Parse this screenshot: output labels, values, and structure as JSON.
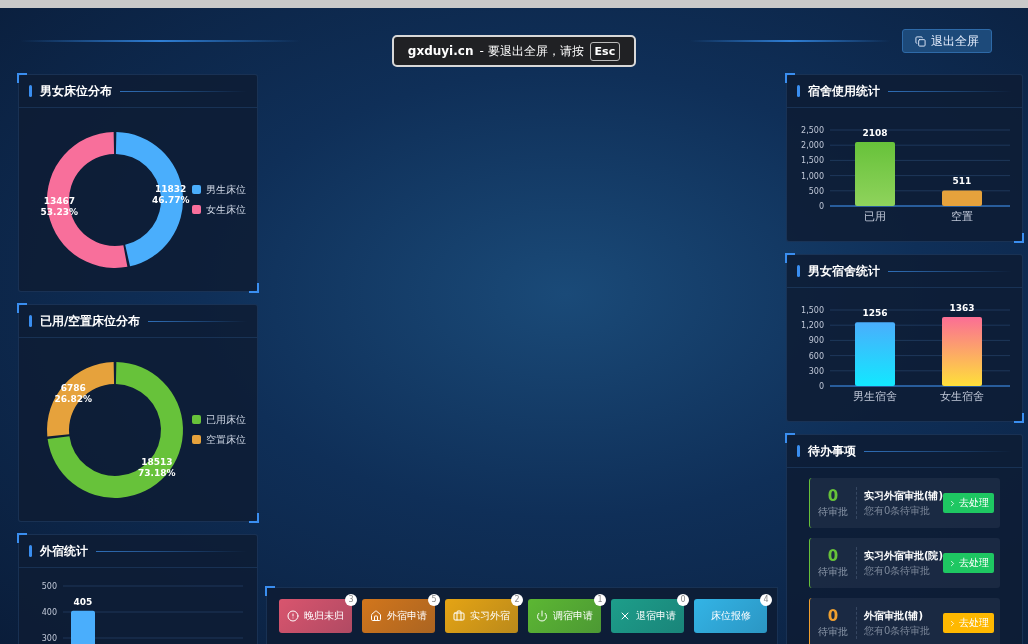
{
  "fullscreen_notice": {
    "site": "gxduyi.cn",
    "message": "- 要退出全屏，请按",
    "key": "Esc"
  },
  "exit_fullscreen_button": "退出全屏",
  "left_panels": [
    {
      "title": "男女床位分布",
      "chart_data": {
        "type": "donut",
        "categories": [
          "男生床位",
          "女生床位"
        ],
        "values": [
          11832,
          13467
        ],
        "colors": [
          "#4aaefc",
          "#f86f9b"
        ],
        "value_labels": [
          "11832\n46.77%",
          "13467\n53.23%"
        ]
      }
    },
    {
      "title": "已用/空置床位分布",
      "chart_data": {
        "type": "donut",
        "categories": [
          "已用床位",
          "空置床位"
        ],
        "values": [
          18513,
          6786
        ],
        "colors": [
          "#67c23a",
          "#e6a23c"
        ],
        "value_labels": [
          "18513\n73.18%",
          "6786\n26.82%"
        ]
      }
    },
    {
      "title": "外宿统计",
      "chart_data": {
        "type": "bar",
        "values": [
          405
        ],
        "colors": [
          "#4aaefc"
        ],
        "ylim": [
          0,
          500
        ],
        "yticks": [
          300,
          400,
          500
        ],
        "grid": true,
        "data_labels": true
      }
    }
  ],
  "right_panels": [
    {
      "title": "宿舍使用统计",
      "chart_data": {
        "type": "bar",
        "categories": [
          "已用",
          "空置"
        ],
        "values": [
          2108,
          511
        ],
        "colors": [
          [
            "#67c23a",
            "#8fd35c"
          ],
          [
            "#e6a23c",
            "#e6a23c"
          ]
        ],
        "ylim": [
          0,
          2500
        ],
        "yticks": [
          {
            "value": 0,
            "label": "0"
          },
          {
            "value": 500,
            "label": "500"
          },
          {
            "value": 1000,
            "label": "1,000"
          },
          {
            "value": 1500,
            "label": "1,500"
          },
          {
            "value": 2000,
            "label": "2,000"
          },
          {
            "value": 2500,
            "label": "2,500"
          }
        ],
        "grid": true,
        "data_labels": true
      }
    },
    {
      "title": "男女宿舍统计",
      "chart_data": {
        "type": "bar",
        "categories": [
          "男生宿舍",
          "女生宿舍"
        ],
        "values": [
          1256,
          1363
        ],
        "colors": [
          [
            "#4aaefc",
            "#12e8ff"
          ],
          [
            "#fb6e95",
            "#fee03a"
          ]
        ],
        "ylim": [
          0,
          1500
        ],
        "yticks": [
          {
            "value": 0,
            "label": "0"
          },
          {
            "value": 300,
            "label": "300"
          },
          {
            "value": 600,
            "label": "600"
          },
          {
            "value": 900,
            "label": "900"
          },
          {
            "value": 1200,
            "label": "1,200"
          },
          {
            "value": 1500,
            "label": "1,500"
          }
        ],
        "grid": true,
        "data_labels": true
      }
    }
  ],
  "todo": {
    "title": "待办事项",
    "items": [
      {
        "count": "0",
        "count_label": "待审批",
        "title": "实习外宿审批(辅)",
        "subtitle": "您有0条待审批",
        "button": "去处理",
        "kind": "normal"
      },
      {
        "count": "0",
        "count_label": "待审批",
        "title": "实习外宿审批(院)",
        "subtitle": "您有0条待审批",
        "button": "去处理",
        "kind": "normal"
      },
      {
        "count": "0",
        "count_label": "待审批",
        "title": "外宿审批(辅)",
        "subtitle": "您有0条待审批",
        "button": "去处理",
        "kind": "warning"
      }
    ]
  },
  "actions": [
    {
      "label": "晚归未归",
      "badge": "3",
      "color": "#d9556e"
    },
    {
      "label": "外宿申请",
      "badge": "5",
      "color": "#d2761c"
    },
    {
      "label": "实习外宿",
      "badge": "2",
      "color": "#e5a414"
    },
    {
      "label": "调宿申请",
      "badge": "1",
      "color": "#5cb733"
    },
    {
      "label": "退宿申请",
      "badge": "0",
      "color": "#1d9e8a"
    },
    {
      "label": "床位报修",
      "badge": "4",
      "color": "#33b4e6"
    }
  ]
}
